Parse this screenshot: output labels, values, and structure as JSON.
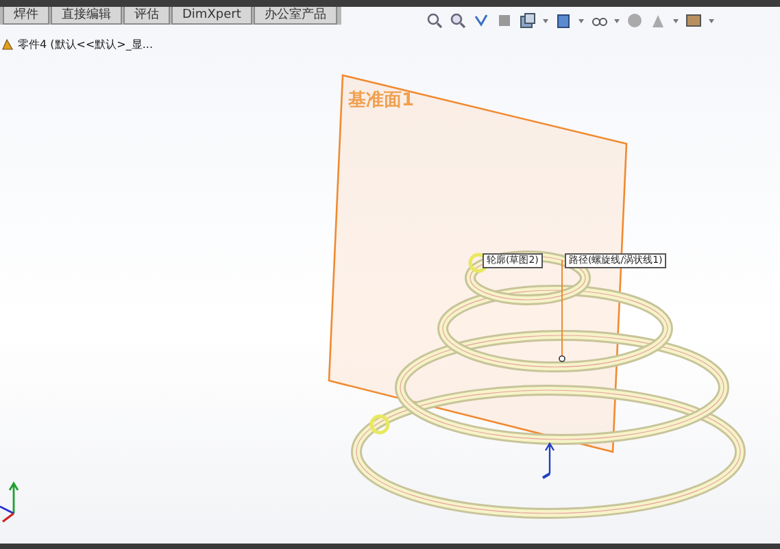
{
  "tabs": [
    {
      "label": "焊件",
      "selected": false
    },
    {
      "label": "直接编辑",
      "selected": false
    },
    {
      "label": "评估",
      "selected": false
    },
    {
      "label": "DimXpert",
      "selected": false
    },
    {
      "label": "办公室产品",
      "selected": false
    }
  ],
  "tree_item": {
    "label": "零件4  (默认<<默认>_显..."
  },
  "plane": {
    "label": "基准面1"
  },
  "callouts": [
    {
      "label": "轮廓(草图2)"
    },
    {
      "label": "路径(螺旋线/涡状线1)"
    }
  ]
}
